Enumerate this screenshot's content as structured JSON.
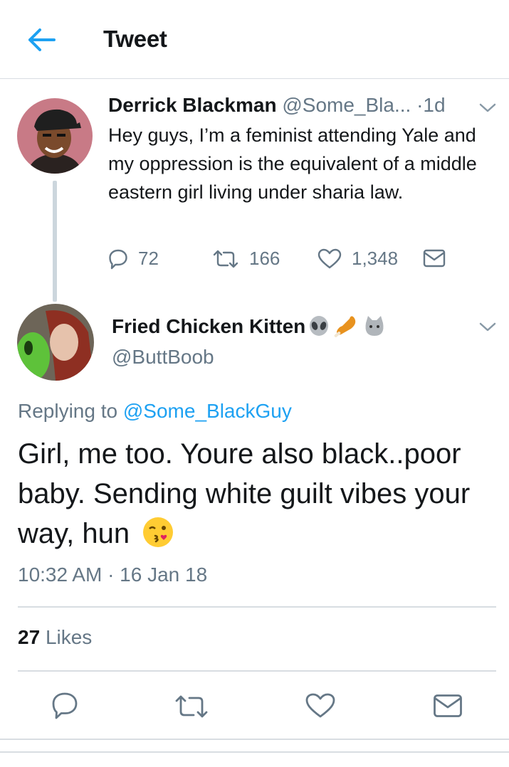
{
  "header": {
    "title": "Tweet",
    "back_icon": "arrow-left-icon",
    "accent": "#1da1f2"
  },
  "parent_tweet": {
    "author_name": "Derrick Blackman",
    "author_handle": "@Some_Bla...",
    "separator": "·",
    "age": "1d",
    "text": "Hey guys, I’m a feminist attending Yale and my oppression is the equivalent of a middle eastern girl living under sharia law.",
    "replies": "72",
    "retweets": "166",
    "likes": "1,348"
  },
  "reply_tweet": {
    "author_name": "Fried Chicken Kitten",
    "name_emoji": [
      "alien-emoji",
      "poultry-leg-emoji",
      "cat-face-emoji"
    ],
    "author_handle": "@ButtBoob",
    "replying_prefix": "Replying to",
    "replying_handle": "@Some_BlackGuy",
    "text": "Girl, me too. Youre also black..poor baby. Sending white guilt vibes your way, hun",
    "text_emoji": "kissing-face-emoji",
    "timestamp": "10:32 AM · 16 Jan 18",
    "likes_count": "27",
    "likes_label": "Likes"
  },
  "action_bar": [
    "reply-icon",
    "retweet-icon",
    "like-icon",
    "direct-message-icon"
  ]
}
